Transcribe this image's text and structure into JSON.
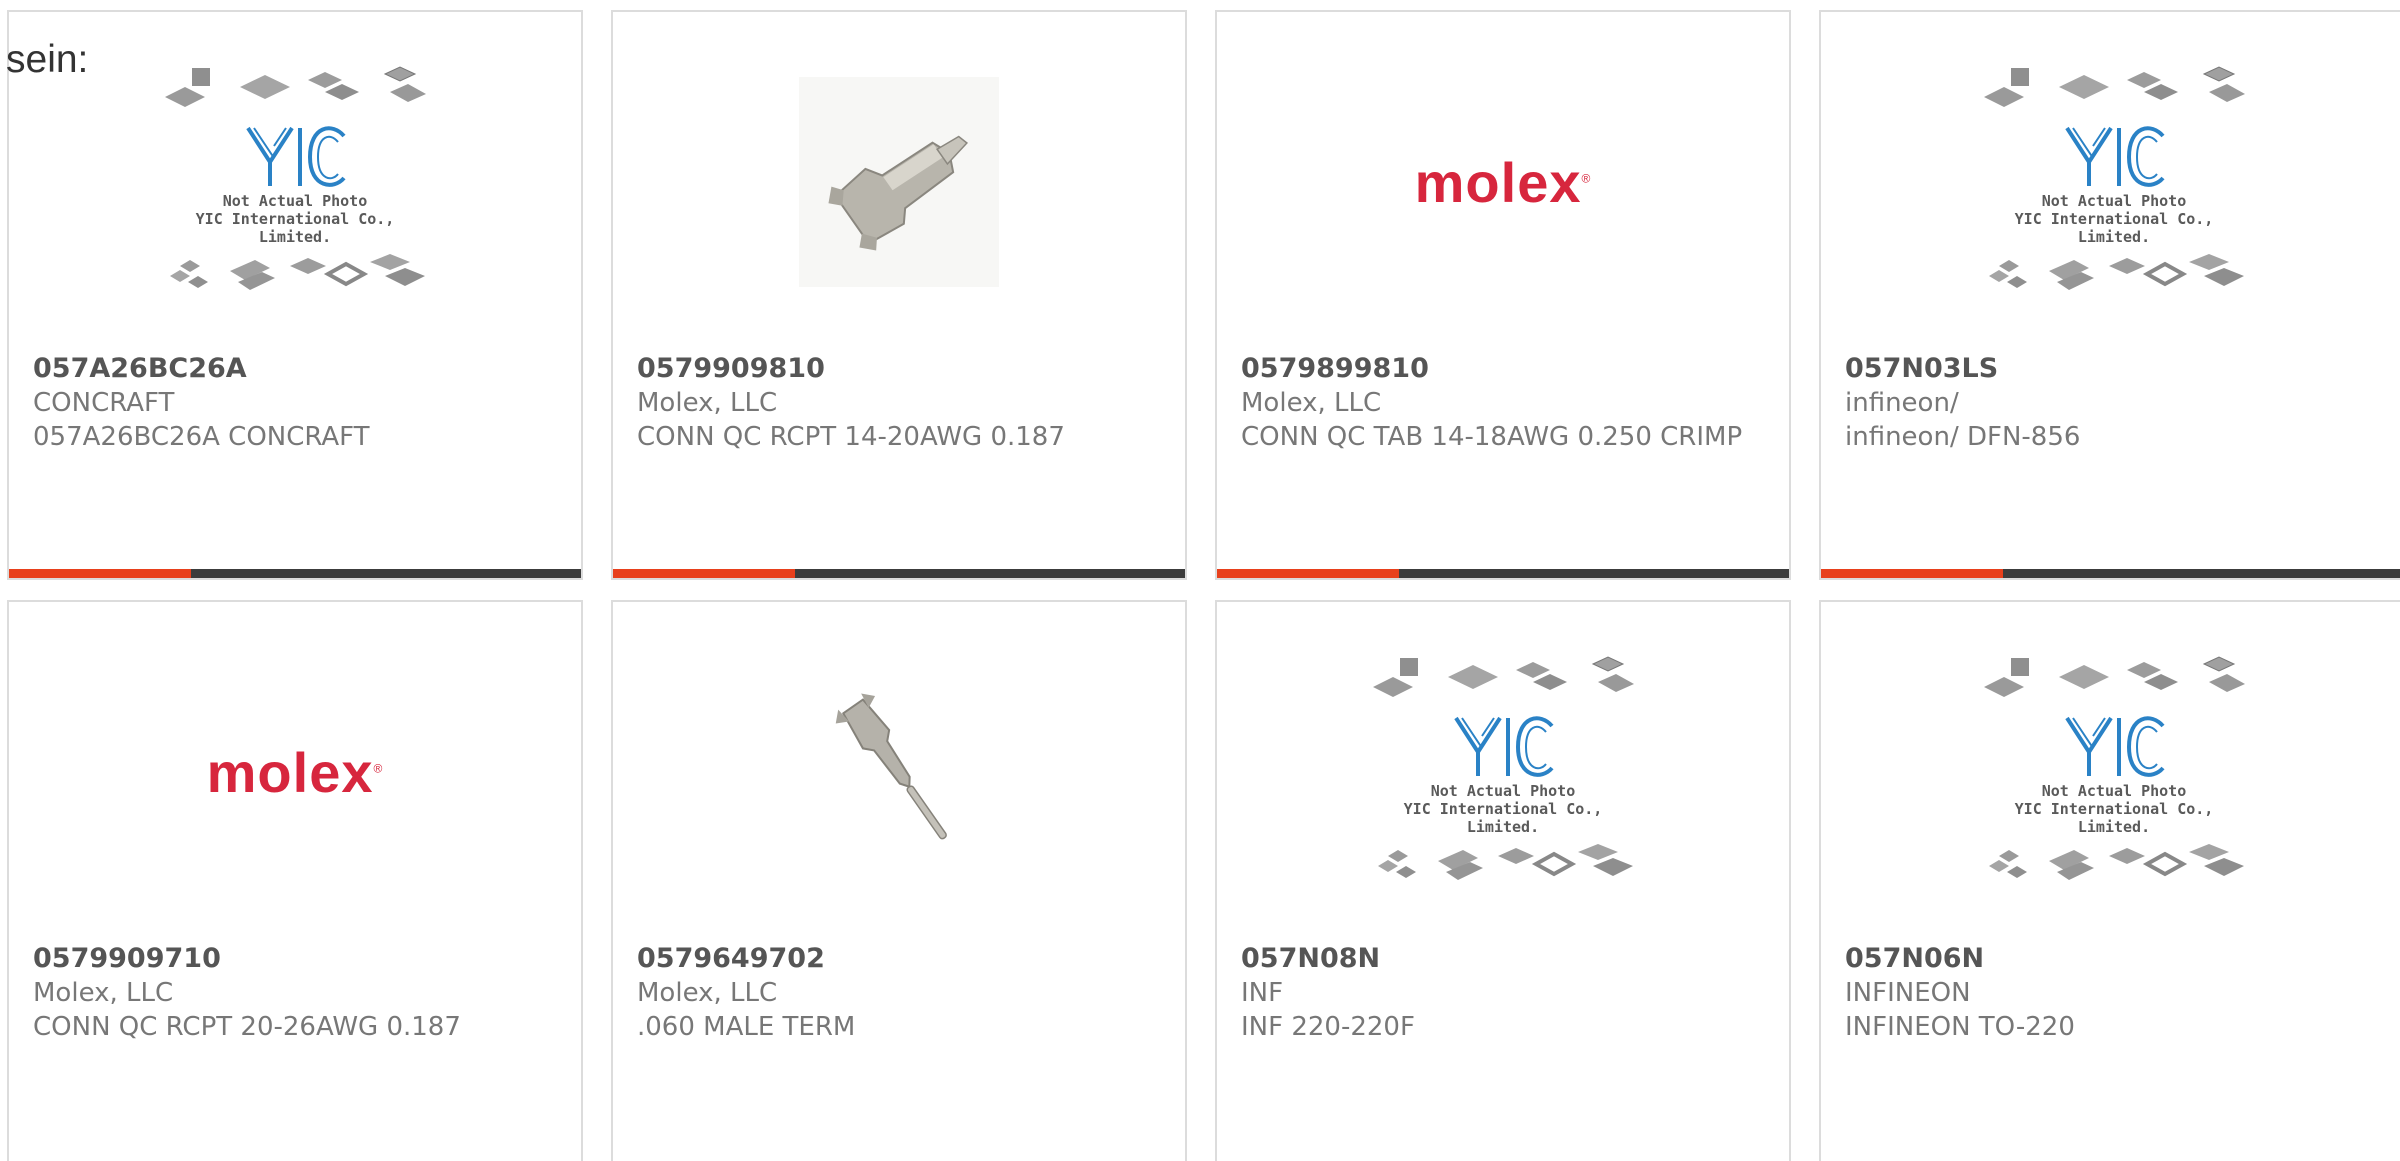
{
  "heading": "sein:",
  "placeholder": {
    "line1": "Not Actual Photo",
    "line2": "YIC International Co., Limited.",
    "logo": "YIC"
  },
  "logos": {
    "molex": "molex"
  },
  "colors": {
    "accent": "#e8401c",
    "bar": "#3c3c3c",
    "molex": "#d7263d"
  },
  "products": [
    {
      "part": "057A26BC26A",
      "manufacturer": "CONCRAFT",
      "description": "057A26BC26A CONCRAFT",
      "image": "yic-placeholder"
    },
    {
      "part": "0579909810",
      "manufacturer": "Molex, LLC",
      "description": "CONN QC RCPT 14-20AWG 0.187",
      "image": "crimp-receptacle-photo"
    },
    {
      "part": "0579899810",
      "manufacturer": "Molex, LLC",
      "description": "CONN QC TAB 14-18AWG 0.250 CRIMP",
      "image": "molex-logo"
    },
    {
      "part": "057N03LS",
      "manufacturer": "infineon/",
      "description": "infineon/ DFN-856",
      "image": "yic-placeholder"
    },
    {
      "part": "0579909710",
      "manufacturer": "Molex, LLC",
      "description": "CONN QC RCPT 20-26AWG 0.187",
      "image": "molex-logo"
    },
    {
      "part": "0579649702",
      "manufacturer": "Molex, LLC",
      "description": ".060 MALE TERM",
      "image": "male-terminal-photo"
    },
    {
      "part": "057N08N",
      "manufacturer": "INF",
      "description": "INF 220-220F",
      "image": "yic-placeholder"
    },
    {
      "part": "057N06N",
      "manufacturer": "INFINEON",
      "description": "INFINEON TO-220",
      "image": "yic-placeholder"
    }
  ]
}
